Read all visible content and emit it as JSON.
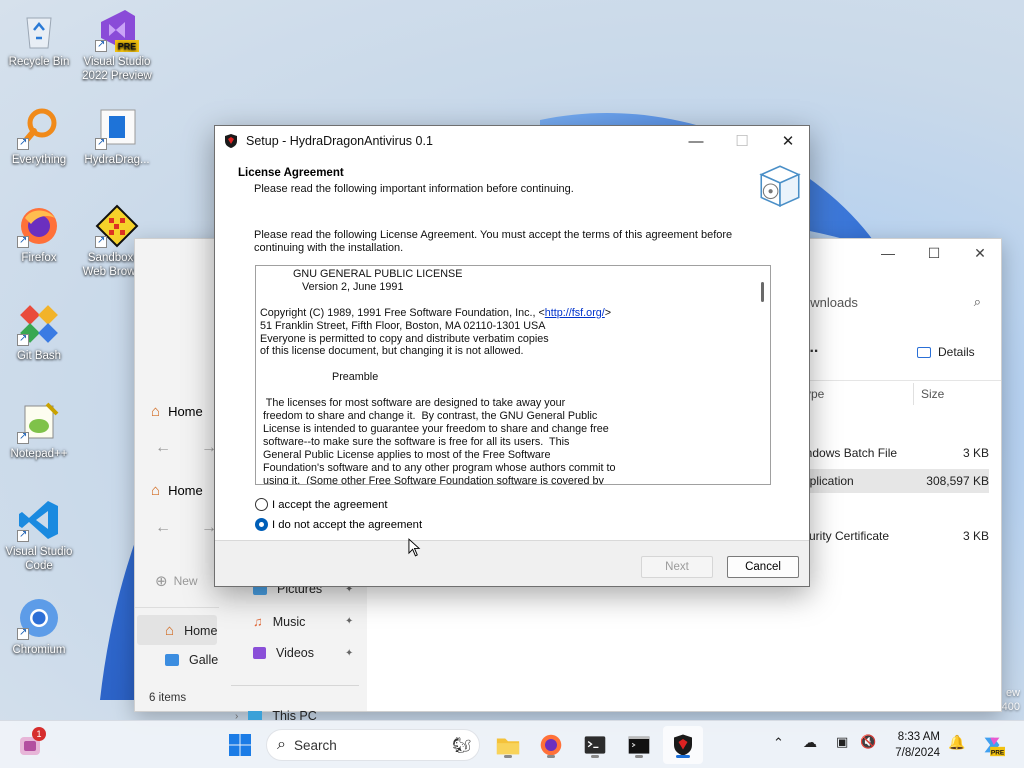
{
  "desktop": {
    "icons": [
      {
        "label": "Recycle Bin"
      },
      {
        "label": "Visual Studio 2022 Preview",
        "badge": "PRE"
      },
      {
        "label": "Everything"
      },
      {
        "label": "HydraDrag..."
      },
      {
        "label": "Firefox"
      },
      {
        "label": "Sandboxed Web Browser"
      },
      {
        "label": "Git Bash"
      },
      {
        "label": "Notepad++"
      },
      {
        "label": "Visual Studio Code"
      },
      {
        "label": "Chromium"
      }
    ],
    "watermark": [
      "ew",
      "400"
    ]
  },
  "explorer": {
    "tabs": [
      "Home",
      "Home"
    ],
    "search_placeholder": "ownloads",
    "new_label": "New",
    "details_label": "Details",
    "more_label": "...",
    "columns": {
      "type": "ype",
      "size": "Size"
    },
    "sidebar": [
      {
        "label": "Home"
      },
      {
        "label": "Galler"
      },
      {
        "label": "Pictures"
      },
      {
        "label": "Music"
      },
      {
        "label": "Videos"
      },
      {
        "label": "This PC"
      }
    ],
    "files": [
      {
        "type": "indows Batch File",
        "size": "3 KB"
      },
      {
        "type": "pplication",
        "size": "308,597 KB"
      },
      {
        "type": "curity Certificate",
        "size": "3 KB"
      }
    ],
    "status": "6 items"
  },
  "dialog": {
    "title": "Setup - HydraDragonAntivirus 0.1",
    "heading": "License Agreement",
    "subheading": "Please read the following important information before continuing.",
    "instruction": "Please read the following License Agreement. You must accept the terms of this agreement before continuing with the installation.",
    "license_lines": [
      "           GNU GENERAL PUBLIC LICENSE",
      "              Version 2, June 1991",
      "",
      "Copyright (C) 1989, 1991 Free Software Foundation, Inc., <",
      "51 Franklin Street, Fifth Floor, Boston, MA 02110-1301 USA",
      "Everyone is permitted to copy and distribute verbatim copies",
      "of this license document, but changing it is not allowed.",
      "",
      "                        Preamble",
      "",
      "  The licenses for most software are designed to take away your",
      " freedom to share and change it.  By contrast, the GNU General Public",
      " License is intended to guarantee your freedom to share and change free",
      " software--to make sure the software is free for all its users.  This",
      " General Public License applies to most of the Free Software",
      " Foundation's software and to any other program whose authors commit to",
      " using it.  (Some other Free Software Foundation software is covered by"
    ],
    "license_link": "http://fsf.org/",
    "license_link_suffix": ">",
    "radio_accept": "I accept the agreement",
    "radio_decline": "I do not accept the agreement",
    "selected": "decline",
    "next_label": "Next",
    "cancel_label": "Cancel"
  },
  "taskbar": {
    "search_placeholder": "Search",
    "notification_count": "1",
    "time": "8:33 AM",
    "date": "7/8/2024",
    "copilot_badge": "PRE"
  }
}
